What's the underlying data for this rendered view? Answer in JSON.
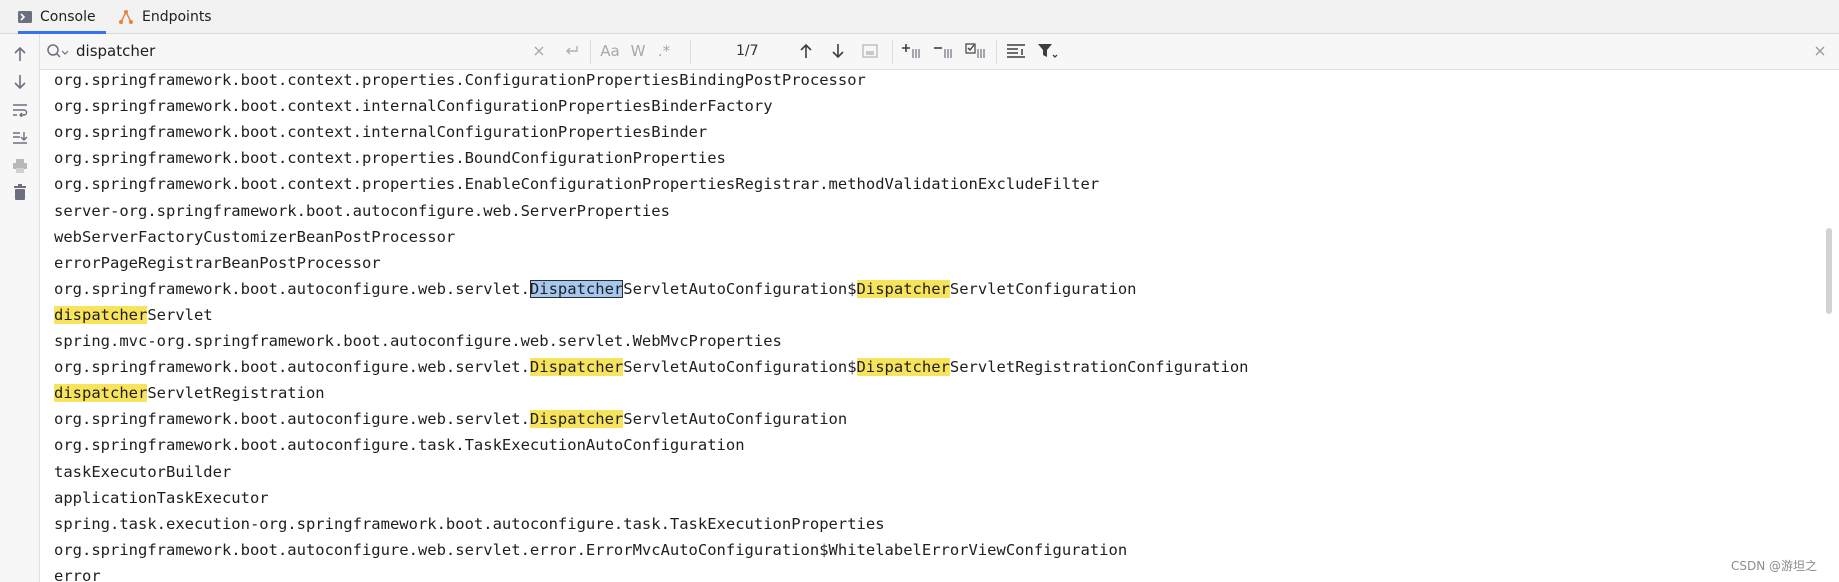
{
  "tabs": [
    {
      "label": "Console",
      "icon": "console-icon",
      "active": true
    },
    {
      "label": "Endpoints",
      "icon": "endpoints-icon",
      "active": false
    }
  ],
  "search": {
    "query": "dispatcher",
    "match_count": "1/7",
    "case_label": "Aa",
    "word_label": "W",
    "regex_label": ".*"
  },
  "lines": [
    [
      {
        "t": "org.springframework.boot.context.properties.ConfigurationPropertiesBindingPostProcessor"
      }
    ],
    [
      {
        "t": "org.springframework.boot.context.internalConfigurationPropertiesBinderFactory"
      }
    ],
    [
      {
        "t": "org.springframework.boot.context.internalConfigurationPropertiesBinder"
      }
    ],
    [
      {
        "t": "org.springframework.boot.context.properties.BoundConfigurationProperties"
      }
    ],
    [
      {
        "t": "org.springframework.boot.context.properties.EnableConfigurationPropertiesRegistrar.methodValidationExcludeFilter"
      }
    ],
    [
      {
        "t": "server-org.springframework.boot.autoconfigure.web.ServerProperties"
      }
    ],
    [
      {
        "t": "webServerFactoryCustomizerBeanPostProcessor"
      }
    ],
    [
      {
        "t": "errorPageRegistrarBeanPostProcessor"
      }
    ],
    [
      {
        "t": "org.springframework.boot.autoconfigure.web.servlet."
      },
      {
        "t": "Dispatcher",
        "h": "current"
      },
      {
        "t": "ServletAutoConfiguration$"
      },
      {
        "t": "Dispatcher",
        "h": "match"
      },
      {
        "t": "ServletConfiguration"
      }
    ],
    [
      {
        "t": "dispatcher",
        "h": "match"
      },
      {
        "t": "Servlet"
      }
    ],
    [
      {
        "t": "spring.mvc-org.springframework.boot.autoconfigure.web.servlet.WebMvcProperties"
      }
    ],
    [
      {
        "t": "org.springframework.boot.autoconfigure.web.servlet."
      },
      {
        "t": "Dispatcher",
        "h": "match"
      },
      {
        "t": "ServletAutoConfiguration$"
      },
      {
        "t": "Dispatcher",
        "h": "match"
      },
      {
        "t": "ServletRegistrationConfiguration"
      }
    ],
    [
      {
        "t": "dispatcher",
        "h": "match"
      },
      {
        "t": "ServletRegistration"
      }
    ],
    [
      {
        "t": "org.springframework.boot.autoconfigure.web.servlet."
      },
      {
        "t": "Dispatcher",
        "h": "match"
      },
      {
        "t": "ServletAutoConfiguration"
      }
    ],
    [
      {
        "t": "org.springframework.boot.autoconfigure.task.TaskExecutionAutoConfiguration"
      }
    ],
    [
      {
        "t": "taskExecutorBuilder"
      }
    ],
    [
      {
        "t": "applicationTaskExecutor"
      }
    ],
    [
      {
        "t": "spring.task.execution-org.springframework.boot.autoconfigure.task.TaskExecutionProperties"
      }
    ],
    [
      {
        "t": "org.springframework.boot.autoconfigure.web.servlet.error.ErrorMvcAutoConfiguration$WhitelabelErrorViewConfiguration"
      }
    ],
    [
      {
        "t": "error"
      }
    ]
  ],
  "watermark": "CSDN @游坦之",
  "colors": {
    "match": "#f8e45c",
    "current_match": "#a6c8f0",
    "accent": "#3574f0",
    "endpoints_icon": "#e8823a"
  }
}
